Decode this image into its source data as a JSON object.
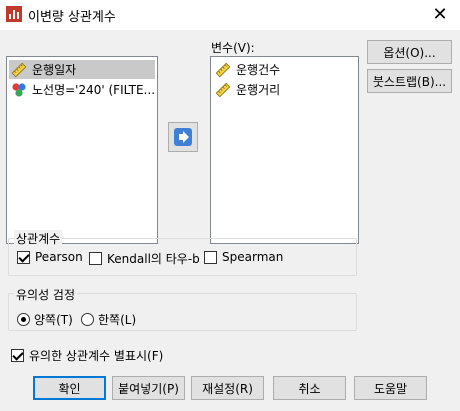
{
  "window": {
    "title": "이변량 상관계수",
    "close_glyph": "✕"
  },
  "source_list": {
    "items": [
      {
        "label": "운행일자",
        "icon": "ruler-scale-icon",
        "selected": true
      },
      {
        "label": "노선명='240' (FILTE...",
        "icon": "nominal-circles-icon",
        "selected": false
      }
    ]
  },
  "move_button_icon": "right-arrow-icon",
  "variables": {
    "label": "변수(V):",
    "items": [
      {
        "label": "운행건수",
        "icon": "ruler-scale-icon"
      },
      {
        "label": "운행거리",
        "icon": "ruler-scale-icon"
      }
    ]
  },
  "side_buttons": {
    "options": "옵션(O)...",
    "bootstrap": "붓스트랩(B)..."
  },
  "correlation": {
    "title": "상관계수",
    "pearson": {
      "label": "Pearson",
      "checked": true
    },
    "kendall": {
      "label": "Kendall의 타우-b",
      "checked": false
    },
    "spearman": {
      "label": "Spearman",
      "checked": false
    }
  },
  "significance": {
    "title": "유의성 검정",
    "two_tailed": {
      "label": "양쪽(T)",
      "checked": true
    },
    "one_tailed": {
      "label": "한쪽(L)",
      "checked": false
    }
  },
  "flag": {
    "label": "유의한 상관계수 별표시(F)",
    "checked": true
  },
  "bottom_buttons": {
    "ok": "확인",
    "paste": "붙여넣기(P)",
    "reset": "재설정(R)",
    "cancel": "취소",
    "help": "도움말"
  },
  "colors": {
    "accent": "#0078d7",
    "arrow": "#3f7fd6",
    "selected_row": "#c9c9c9"
  }
}
